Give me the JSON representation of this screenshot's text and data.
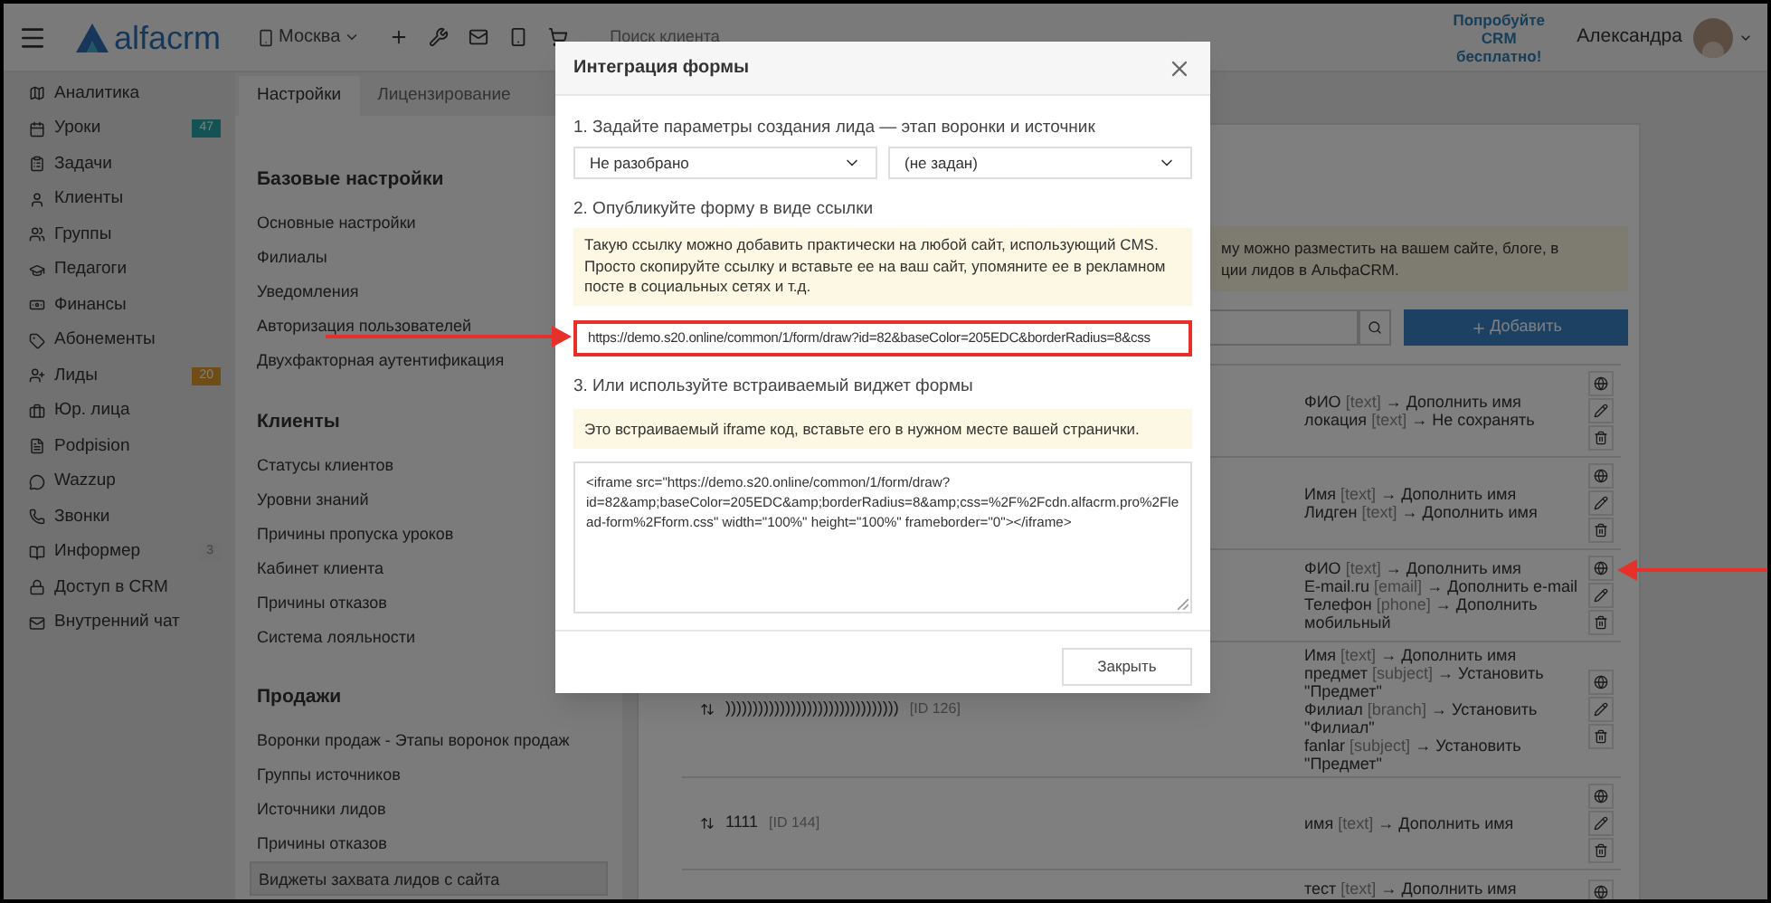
{
  "header": {
    "logo": "alfacrm",
    "city": "Москва",
    "search": {
      "placeholder": "Поиск клиента"
    },
    "promo": "Попробуйте CRM бесплатно!",
    "user": "Александра"
  },
  "sidebar": {
    "items": [
      {
        "label": "Аналитика"
      },
      {
        "label": "Уроки",
        "badge": "47",
        "color": "#155254"
      },
      {
        "label": "Задачи"
      },
      {
        "label": "Клиенты"
      },
      {
        "label": "Группы"
      },
      {
        "label": "Педагоги"
      },
      {
        "label": "Финансы"
      },
      {
        "label": "Абонементы"
      },
      {
        "label": "Лиды",
        "badge": "20",
        "color": "#704d16"
      },
      {
        "label": "Юр. лица"
      },
      {
        "label": "Podpision"
      },
      {
        "label": "Wazzup"
      },
      {
        "label": "Звонки"
      },
      {
        "label": "Информер",
        "badge": "3",
        "color": "#6f6f6f"
      },
      {
        "label": "Доступ в CRM"
      },
      {
        "label": "Внутренний чат"
      }
    ]
  },
  "tabs": [
    {
      "label": "Настройки",
      "selected": true
    },
    {
      "label": "Лицензирование",
      "selected": false
    }
  ],
  "settings": {
    "sections": [
      {
        "title": "Базовые настройки",
        "items": [
          {
            "label": "Основные настройки",
            "selected": false
          },
          {
            "label": "Филиалы",
            "selected": false
          },
          {
            "label": "Уведомления",
            "selected": false
          },
          {
            "label": "Авторизация пользователей",
            "selected": false
          },
          {
            "label": "Двухфакторная аутентификация",
            "selected": false
          }
        ]
      },
      {
        "title": "Клиенты",
        "items": [
          {
            "label": "Статусы клиентов",
            "selected": false
          },
          {
            "label": "Уровни знаний",
            "selected": false
          },
          {
            "label": "Причины пропуска уроков",
            "selected": false
          },
          {
            "label": "Кабинет клиента",
            "selected": false
          },
          {
            "label": "Причины отказов",
            "selected": false
          },
          {
            "label": "Система лояльности",
            "selected": false
          }
        ]
      },
      {
        "title": "Продажи",
        "items": [
          {
            "label": "Воронки продаж - Этапы воронок продаж",
            "selected": false
          },
          {
            "label": "Группы источников",
            "selected": false
          },
          {
            "label": "Источники лидов",
            "selected": false
          },
          {
            "label": "Причины отказов",
            "selected": false
          },
          {
            "label": "Виджеты захвата лидов с сайта",
            "selected": true
          }
        ]
      }
    ]
  },
  "widgets": {
    "info": [
      "му можно разместить на вашем сайте, блоге, в",
      "ции лидов в АльфаCRM."
    ],
    "add_button": "Добавить",
    "rows": [
      {
        "mappings": [
          {
            "field": "ФИО",
            "type": "[text]",
            "action": "→ Дополнить имя"
          },
          {
            "field": "локация",
            "type": "[text]",
            "action": "→ Не сохранять"
          }
        ]
      },
      {
        "mappings": [
          {
            "field": "Имя",
            "type": "[text]",
            "action": "→ Дополнить имя"
          },
          {
            "field": "Лидген",
            "type": "[text]",
            "action": "→ Дополнить имя"
          }
        ]
      },
      {
        "mappings": [
          {
            "field": "ФИО",
            "type": "[text]",
            "action": "→ Дополнить имя"
          },
          {
            "field": "E-mail.ru",
            "type": "[email]",
            "action": "→ Дополнить e-mail"
          },
          {
            "field": "Телефон",
            "type": "[phone]",
            "action": "→ Дополнить мобильный"
          }
        ]
      },
      {
        "name": "))))))))))))))))))))))))))))))))",
        "id": "[ID 126]",
        "mappings": [
          {
            "field": "Имя",
            "type": "[text]",
            "action": "→ Дополнить имя"
          },
          {
            "field": "предмет",
            "type": "[subject]",
            "action": "→ Установить \"Предмет\""
          },
          {
            "field": "Филиал",
            "type": "[branch]",
            "action": "→ Установить \"Филиал\""
          },
          {
            "field": "fanlar",
            "type": "[subject]",
            "action": "→ Установить \"Предмет\""
          }
        ]
      },
      {
        "name": "1111",
        "id": "[ID 144]",
        "mappings": [
          {
            "field": "имя",
            "type": "[text]",
            "action": "→ Дополнить имя"
          }
        ]
      },
      {
        "mappings": [
          {
            "field": "тест",
            "type": "[text]",
            "action": "→ Дополнить имя"
          }
        ]
      }
    ]
  },
  "modal": {
    "title": "Интеграция формы",
    "step1": "1. Задайте параметры создания лида — этап воронки и источник",
    "selects": [
      "Не разобрано",
      "(не задан)"
    ],
    "step2": "2. Опубликуйте форму в виде ссылки",
    "note2": "Такую ссылку можно добавить практически на любой сайт, использующий CMS. Просто скопируйте ссылку и вставьте ее на ваш сайт, упомяните ее в рекламном посте в социальных сетях и т.д.",
    "url": {
      "value": "https://demo.s20.online/common/1/form/draw?id=82&baseColor=205EDC&borderRadius=8&css",
      "highlighted": true
    },
    "step3": "3. Или используйте встраиваемый виджет формы",
    "note3": "Это встраиваемый iframe код, вставьте его в нужном месте вашей странички.",
    "code": "<iframe src=\"https://demo.s20.online/common/1/form/draw?id=82&amp;baseColor=205EDC&amp;borderRadius=8&amp;css=%2F%2Fcdn.alfacrm.pro%2Flead-form%2Fform.css\" width=\"100%\" height=\"100%\" frameborder=\"0\"></iframe>",
    "close_button": "Закрыть"
  }
}
